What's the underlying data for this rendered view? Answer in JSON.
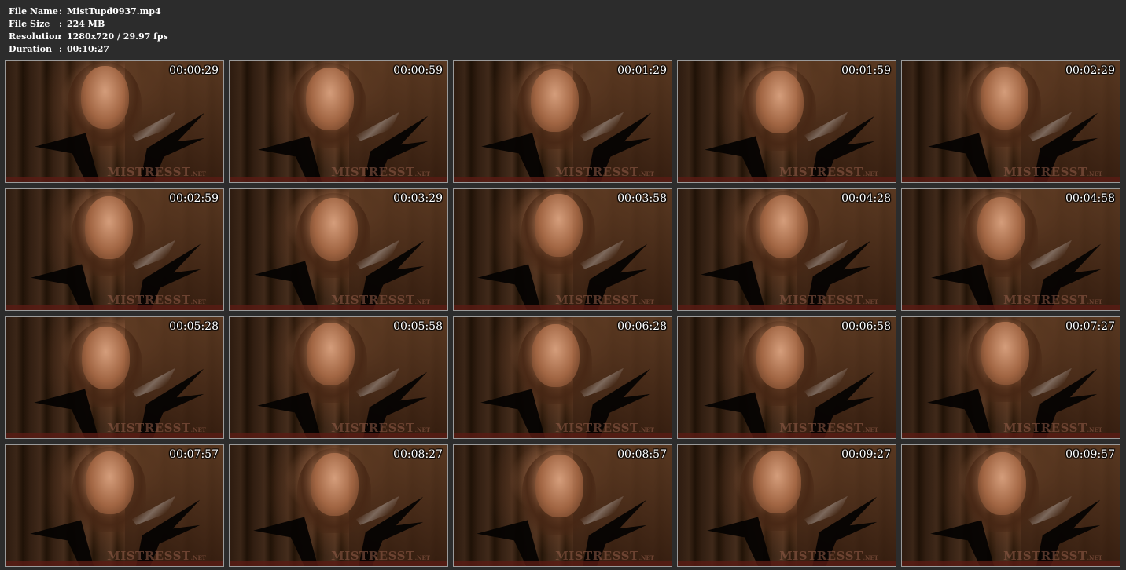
{
  "file_info": {
    "rows": [
      {
        "label": "File Name",
        "sep": ":",
        "value": "MistTupd0937.mp4"
      },
      {
        "label": "File Size",
        "sep": ":",
        "value": "224 MB"
      },
      {
        "label": "Resolution",
        "sep": ":",
        "value": "1280x720 / 29.97 fps"
      },
      {
        "label": "Duration",
        "sep": ":",
        "value": "00:10:27"
      }
    ]
  },
  "watermark": {
    "main": "MISTRESST",
    "suffix": ".NET"
  },
  "thumbnails": [
    {
      "time": "00:00:29"
    },
    {
      "time": "00:00:59"
    },
    {
      "time": "00:01:29"
    },
    {
      "time": "00:01:59"
    },
    {
      "time": "00:02:29"
    },
    {
      "time": "00:02:59"
    },
    {
      "time": "00:03:29"
    },
    {
      "time": "00:03:58"
    },
    {
      "time": "00:04:28"
    },
    {
      "time": "00:04:58"
    },
    {
      "time": "00:05:28"
    },
    {
      "time": "00:05:58"
    },
    {
      "time": "00:06:28"
    },
    {
      "time": "00:06:58"
    },
    {
      "time": "00:07:27"
    },
    {
      "time": "00:07:57"
    },
    {
      "time": "00:08:27"
    },
    {
      "time": "00:08:57"
    },
    {
      "time": "00:09:27"
    },
    {
      "time": "00:09:57"
    }
  ]
}
